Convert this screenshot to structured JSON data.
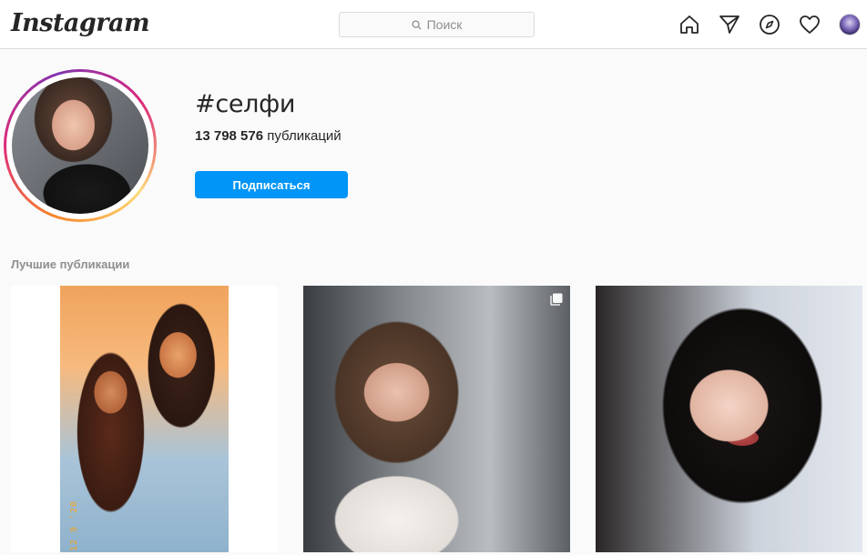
{
  "app": {
    "logo_text": "Instagram"
  },
  "search": {
    "placeholder": "Поиск",
    "icon": "search-icon"
  },
  "nav": {
    "icons": [
      "home-icon",
      "direct-send-icon",
      "explore-compass-icon",
      "activity-heart-icon",
      "profile-avatar"
    ]
  },
  "hashtag": {
    "title": "#селфи",
    "post_count": "13 798 576",
    "post_count_suffix": " публикаций",
    "follow_label": "Подписаться"
  },
  "posts_section": {
    "label": "Лучшие публикации",
    "posts": [
      {
        "stamp": "12 9 '20"
      },
      {
        "icon": "multiple-photos-icon"
      },
      {}
    ]
  },
  "colors": {
    "accent": "#0095f6",
    "text": "#262626",
    "muted": "#8e8e8e",
    "border": "#dbdbdb",
    "background": "#fafafa"
  }
}
